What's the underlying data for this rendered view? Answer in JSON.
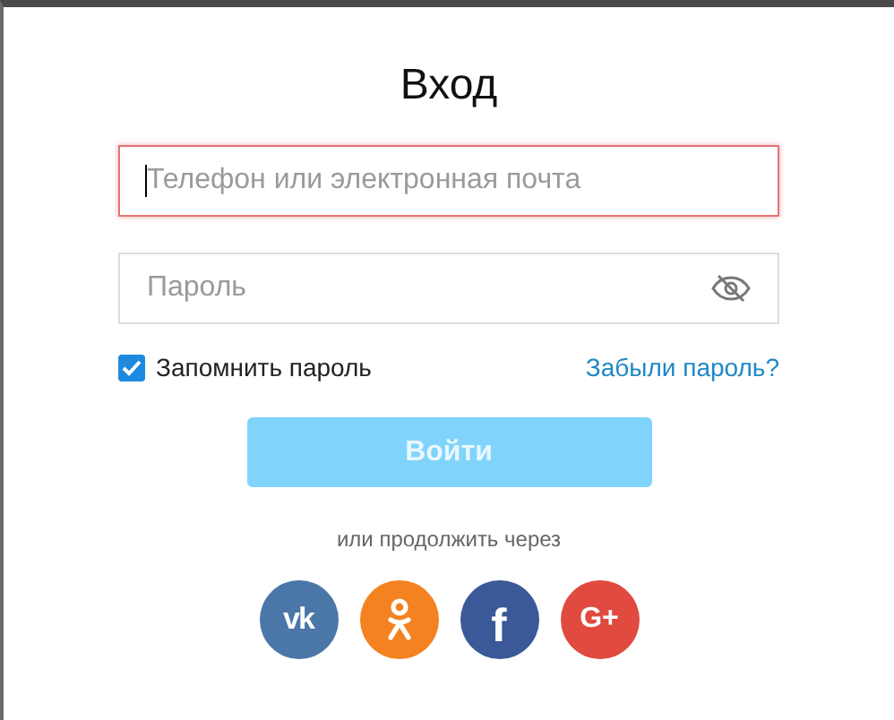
{
  "title": "Вход",
  "login_field": {
    "placeholder": "Телефон или электронная почта",
    "focused": true,
    "error": true
  },
  "password_field": {
    "placeholder": "Пароль"
  },
  "remember": {
    "label": "Запомнить пароль",
    "checked": true
  },
  "forgot_link": "Забыли пароль?",
  "submit": {
    "label": "Войти",
    "disabled": true
  },
  "alt_text": "или продолжить через",
  "social": [
    {
      "kind": "vk",
      "label": "vk",
      "color": "#4a76a8"
    },
    {
      "kind": "ok",
      "color": "#f58220"
    },
    {
      "kind": "facebook",
      "label": "f",
      "color": "#3b5998"
    },
    {
      "kind": "google",
      "label": "G+",
      "color": "#e04a3f"
    }
  ]
}
